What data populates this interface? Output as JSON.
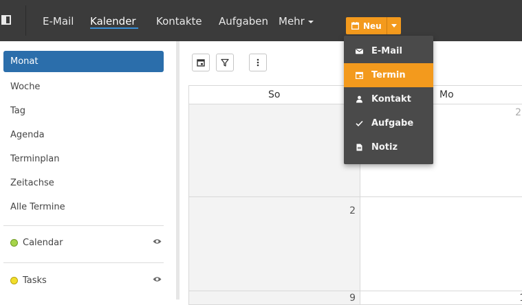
{
  "nav": {
    "items": [
      "E-Mail",
      "Kalender",
      "Kontakte",
      "Aufgaben",
      "Mehr"
    ],
    "active": "Kalender",
    "new_button": "Neu"
  },
  "new_menu": {
    "items": [
      {
        "label": "E-Mail",
        "icon": "envelope-icon"
      },
      {
        "label": "Termin",
        "icon": "calendar-icon"
      },
      {
        "label": "Kontakt",
        "icon": "person-icon"
      },
      {
        "label": "Aufgabe",
        "icon": "check-icon"
      },
      {
        "label": "Notiz",
        "icon": "note-icon"
      }
    ],
    "highlighted": "Termin"
  },
  "sidebar": {
    "views": [
      "Monat",
      "Woche",
      "Tag",
      "Agenda",
      "Terminplan",
      "Zeitachse",
      "Alle Termine"
    ],
    "active_view": "Monat",
    "calendars": [
      {
        "label": "Calendar",
        "color": "#a6d44a"
      },
      {
        "label": "Tasks",
        "color": "#f2de2b"
      }
    ]
  },
  "calendar": {
    "headers": [
      "So",
      "Mo"
    ],
    "row1": [
      "",
      "2"
    ],
    "row2": [
      "2",
      ""
    ],
    "row3": [
      "9",
      "1"
    ]
  },
  "colors": {
    "topbar": "#3b3b3b",
    "accent": "#f39a1d",
    "active_blue": "#2b6eab"
  }
}
